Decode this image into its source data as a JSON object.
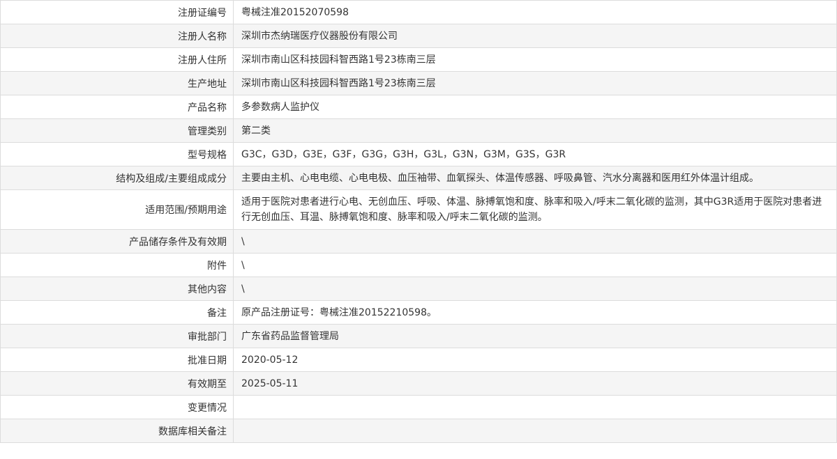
{
  "rows": [
    {
      "label": "注册证编号",
      "value": "粤械注准20152070598"
    },
    {
      "label": "注册人名称",
      "value": "深圳市杰纳瑞医疗仪器股份有限公司"
    },
    {
      "label": "注册人住所",
      "value": "深圳市南山区科技园科智西路1号23栋南三层"
    },
    {
      "label": "生产地址",
      "value": "深圳市南山区科技园科智西路1号23栋南三层"
    },
    {
      "label": "产品名称",
      "value": "多参数病人监护仪"
    },
    {
      "label": "管理类别",
      "value": "第二类"
    },
    {
      "label": "型号规格",
      "value": "G3C，G3D，G3E，G3F，G3G，G3H，G3L，G3N，G3M，G3S，G3R"
    },
    {
      "label": "结构及组成/主要组成成分",
      "value": "主要由主机、心电电缆、心电电极、血压袖带、血氧探头、体温传感器、呼吸鼻管、汽水分离器和医用红外体温计组成。"
    },
    {
      "label": "适用范围/预期用途",
      "value": "适用于医院对患者进行心电、无创血压、呼吸、体温、脉搏氧饱和度、脉率和吸入/呼末二氧化碳的监测，其中G3R适用于医院对患者进行无创血压、耳温、脉搏氧饱和度、脉率和吸入/呼末二氧化碳的监测。"
    },
    {
      "label": "产品储存条件及有效期",
      "value": "\\"
    },
    {
      "label": "附件",
      "value": "\\"
    },
    {
      "label": "其他内容",
      "value": "\\"
    },
    {
      "label": "备注",
      "value": "原产品注册证号：粤械注准20152210598。"
    },
    {
      "label": "审批部门",
      "value": "广东省药品监督管理局"
    },
    {
      "label": "批准日期",
      "value": "2020-05-12"
    },
    {
      "label": "有效期至",
      "value": "2025-05-11"
    },
    {
      "label": "变更情况",
      "value": ""
    },
    {
      "label": "数据库相关备注",
      "value": ""
    }
  ]
}
